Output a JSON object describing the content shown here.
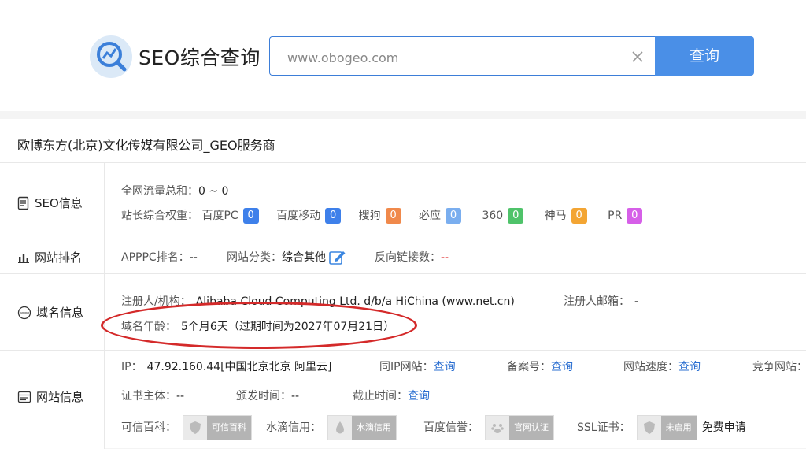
{
  "header": {
    "brand": "SEO综合查询",
    "search_placeholder": "www.obogeo.com",
    "search_button": "查询"
  },
  "company_title": "欧博东方(北京)文化传媒有限公司_GEO服务商",
  "seo": {
    "label": "SEO信息",
    "traffic_label": "全网流量总和：",
    "traffic_value": "0 ~ 0",
    "weight_label": "站长综合权重：",
    "weights": [
      {
        "name": "百度PC",
        "value": "0",
        "color": "#3e80ea"
      },
      {
        "name": "百度移动",
        "value": "0",
        "color": "#3e80ea"
      },
      {
        "name": "搜狗",
        "value": "0",
        "color": "#f0894b"
      },
      {
        "name": "必应",
        "value": "0",
        "color": "#7aaeef"
      },
      {
        "name": "360",
        "value": "0",
        "color": "#4fc36a"
      },
      {
        "name": "神马",
        "value": "0",
        "color": "#f3a533"
      },
      {
        "name": "PR",
        "value": "0",
        "color": "#d65fe8"
      }
    ]
  },
  "rank": {
    "label": "网站排名",
    "apppc_label": "APPPC排名：",
    "apppc_value": "--",
    "category_label": "网站分类：",
    "category_value": "综合其他",
    "backlinks_label": "反向链接数：",
    "backlinks_value": "--"
  },
  "domain": {
    "label": "域名信息",
    "registrant_label": "注册人/机构：",
    "registrant_value": "Alibaba Cloud Computing Ltd. d/b/a HiChina (www.net.cn)",
    "email_label": "注册人邮箱：",
    "email_value": "-",
    "age_label": "域名年龄：",
    "age_value": "5个月6天（过期时间为2027年07月21日）"
  },
  "site": {
    "label": "网站信息",
    "ip_label": "IP：",
    "ip_value": "47.92.160.44[中国北京北京 阿里云]",
    "same_ip_label": "同IP网站：",
    "query": "查询",
    "icp_label": "备案号：",
    "speed_label": "网站速度：",
    "competitor_label": "竞争网站：",
    "cert_subject_label": "证书主体：",
    "cert_subject_value": "--",
    "issue_label": "颁发时间：",
    "issue_value": "--",
    "expire_label": "截止时间：",
    "trust_label": "可信百科：",
    "trust_badge": "可信百科",
    "water_label": "水滴信用：",
    "water_badge": "水滴信用",
    "baidu_label": "百度信誉：",
    "baidu_badge": "官网认证",
    "ssl_label": "SSL证书：",
    "ssl_badge": "未启用",
    "ssl_apply": "免费申请"
  }
}
